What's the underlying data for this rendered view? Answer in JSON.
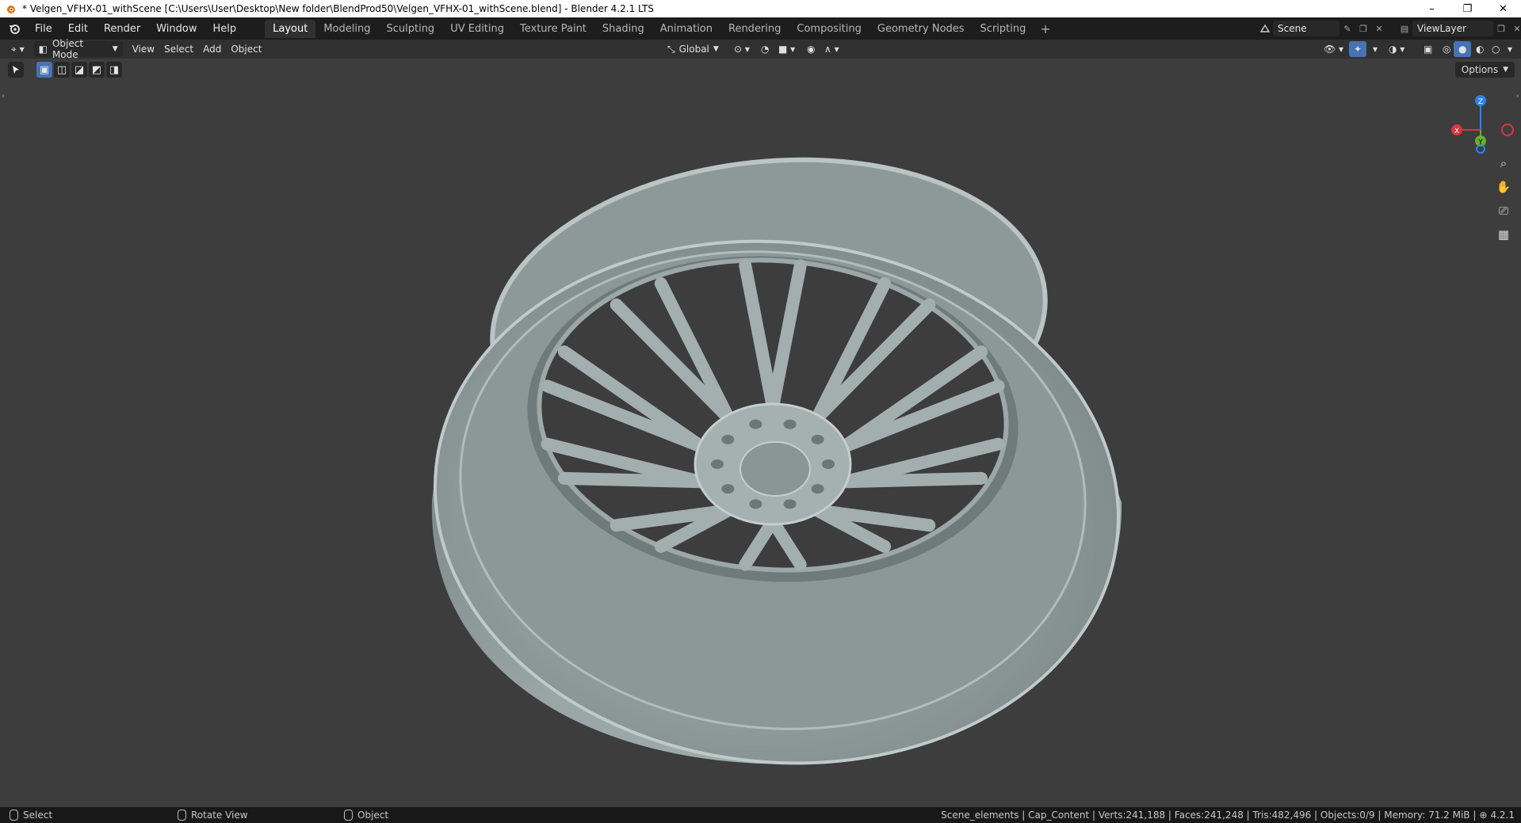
{
  "window": {
    "title": "* Velgen_VFHX-01_withScene [C:\\Users\\User\\Desktop\\New folder\\BlendProd50\\Velgen_VFHX-01_withScene.blend] - Blender 4.2.1 LTS",
    "minimize": "–",
    "restore": "❐",
    "close": "✕"
  },
  "menu": [
    "File",
    "Edit",
    "Render",
    "Window",
    "Help"
  ],
  "workspaces": {
    "active": "Layout",
    "tabs": [
      "Layout",
      "Modeling",
      "Sculpting",
      "UV Editing",
      "Texture Paint",
      "Shading",
      "Animation",
      "Rendering",
      "Compositing",
      "Geometry Nodes",
      "Scripting"
    ],
    "add": "+"
  },
  "scene": {
    "name": "Scene",
    "view_layer": "ViewLayer"
  },
  "header": {
    "mode": "Object Mode",
    "menus": [
      "View",
      "Select",
      "Add",
      "Object"
    ],
    "orientation": "Global"
  },
  "viewport": {
    "options_label": "Options",
    "gizmo": {
      "x": "X",
      "y": "Y",
      "z": "Z",
      "x_color": "#d9363e",
      "y_color": "#6bae2a",
      "z_color": "#2f83e4"
    },
    "nav_icons": [
      "zoom-icon",
      "hand-pan-icon",
      "camera-icon",
      "grid-icon"
    ]
  },
  "statusbar": {
    "items": [
      {
        "label": "Select"
      },
      {
        "label": "Rotate View"
      },
      {
        "label": "Object"
      }
    ],
    "stats": "Scene_elements | Cap_Content | Verts:241,188 | Faces:241,248 | Tris:482,496 | Objects:0/9 | Memory: 71.2 MiB |",
    "version": "4.2.1"
  },
  "colors": {
    "accent": "#4772b3",
    "viewport_bg": "#3d3d3d",
    "wheel": "#9aa7a6"
  }
}
